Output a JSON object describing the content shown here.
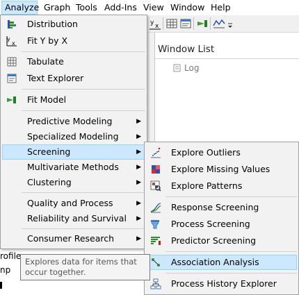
{
  "menubar": [
    {
      "label": "Analyze",
      "active": true
    },
    {
      "label": "Graph"
    },
    {
      "label": "Tools"
    },
    {
      "label": "Add-Ins"
    },
    {
      "label": "View"
    },
    {
      "label": "Window"
    },
    {
      "label": "Help"
    }
  ],
  "window_list": {
    "title": "Window List",
    "items": [
      {
        "label": "Log",
        "icon": "log-icon"
      }
    ]
  },
  "background_text": [
    "rofile",
    "np"
  ],
  "analyze_menu": {
    "items": [
      {
        "label": "Distribution",
        "icon": "distribution-icon"
      },
      {
        "label": "Fit Y by X",
        "icon": "fit-y-by-x-icon"
      },
      {
        "label": "Tabulate",
        "icon": "tabulate-icon"
      },
      {
        "label": "Text Explorer",
        "icon": "text-explorer-icon"
      },
      {
        "label": "Fit Model",
        "icon": "fit-model-icon"
      },
      {
        "label": "Predictive Modeling",
        "submenu": true
      },
      {
        "label": "Specialized Modeling",
        "submenu": true
      },
      {
        "label": "Screening",
        "submenu": true,
        "highlighted": true
      },
      {
        "label": "Multivariate Methods",
        "submenu": true
      },
      {
        "label": "Clustering",
        "submenu": true
      },
      {
        "label": "Quality and Process",
        "submenu": true
      },
      {
        "label": "Reliability and Survival",
        "submenu": true
      },
      {
        "label": "Consumer Research",
        "submenu": true
      }
    ]
  },
  "screening_menu": {
    "items": [
      {
        "label": "Explore Outliers",
        "icon": "explore-outliers-icon"
      },
      {
        "label": "Explore Missing Values",
        "icon": "explore-missing-values-icon"
      },
      {
        "label": "Explore Patterns",
        "icon": "explore-patterns-icon"
      },
      {
        "label": "Response Screening",
        "icon": "response-screening-icon"
      },
      {
        "label": "Process Screening",
        "icon": "process-screening-icon"
      },
      {
        "label": "Predictor Screening",
        "icon": "predictor-screening-icon"
      },
      {
        "label": "Association Analysis",
        "icon": "association-analysis-icon",
        "highlighted": true
      },
      {
        "label": "Process History Explorer",
        "icon": "process-history-explorer-icon"
      }
    ]
  },
  "tooltip": {
    "text": "Explores data for items that occur together."
  },
  "colors": {
    "highlight_bg": "#cce8ff",
    "highlight_border": "#99d1ff",
    "menu_bg": "#f2f2f2"
  }
}
